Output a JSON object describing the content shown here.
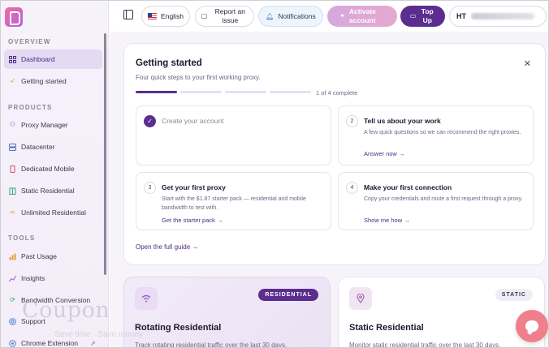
{
  "sidebar": {
    "sections": [
      {
        "label": "OVERVIEW"
      },
      {
        "label": "PRODUCTS"
      },
      {
        "label": "TOOLS"
      }
    ],
    "items": [
      {
        "label": "Dashboard",
        "icon": "grid-icon",
        "active": true
      },
      {
        "label": "Getting started",
        "icon": "rocket-icon"
      },
      {
        "label": "Proxy Manager",
        "icon": "nodes-icon"
      },
      {
        "label": "Datacenter",
        "icon": "server-icon"
      },
      {
        "label": "Dedicated Mobile",
        "icon": "mobile-icon"
      },
      {
        "label": "Static Residential",
        "icon": "building-icon"
      },
      {
        "label": "Unlimited Residential",
        "icon": "infinity-icon"
      },
      {
        "label": "Past Usage",
        "icon": "bar-chart-icon"
      },
      {
        "label": "Insights",
        "icon": "trend-icon"
      },
      {
        "label": "Bandwidth Conversion",
        "icon": "refresh-icon"
      },
      {
        "label": "Support",
        "icon": "support-icon"
      },
      {
        "label": "Chrome Extension",
        "icon": "extension-icon"
      }
    ]
  },
  "watermark": {
    "text": "Coupon",
    "sub": "Save time · Save money"
  },
  "topbar": {
    "language": "English",
    "report": "Report an issue",
    "notifications": "Notifications",
    "activate": "Activate account",
    "topup": "Top Up",
    "initials": "HT"
  },
  "getting_started": {
    "title": "Getting started",
    "subtitle": "Four quick steps to your first working proxy.",
    "progress_text": "1 of 4 complete",
    "progress": {
      "completed": 1,
      "total": 4
    },
    "steps": [
      {
        "num": "✓",
        "title": "Create your account",
        "desc": "",
        "link": "",
        "done": true
      },
      {
        "num": "2",
        "title": "Tell us about your work",
        "desc": "A few quick questions so we can recommend the right proxies.",
        "link": "Answer now →"
      },
      {
        "num": "3",
        "title": "Get your first proxy",
        "desc": "Start with the $1.87 starter pack — residential and mobile bandwidth to test with.",
        "link": "Get the starter pack →"
      },
      {
        "num": "4",
        "title": "Make your first connection",
        "desc": "Copy your credentials and route a first request through a proxy.",
        "link": "Show me how →"
      }
    ],
    "guide_link": "Open the full guide →"
  },
  "products": [
    {
      "title": "Rotating Residential",
      "badge": "RESIDENTIAL",
      "desc": "Track rotating residential traffic over the last 30 days.",
      "icon": "wifi-icon"
    },
    {
      "title": "Static Residential",
      "badge": "STATIC",
      "desc": "Monitor static residential traffic over the last 30 days.",
      "icon": "location-pin-icon"
    }
  ],
  "colors": {
    "accent": "#5a2d8f",
    "active_nav": "#e4daf2",
    "chat_fab": "#f07f8c"
  }
}
